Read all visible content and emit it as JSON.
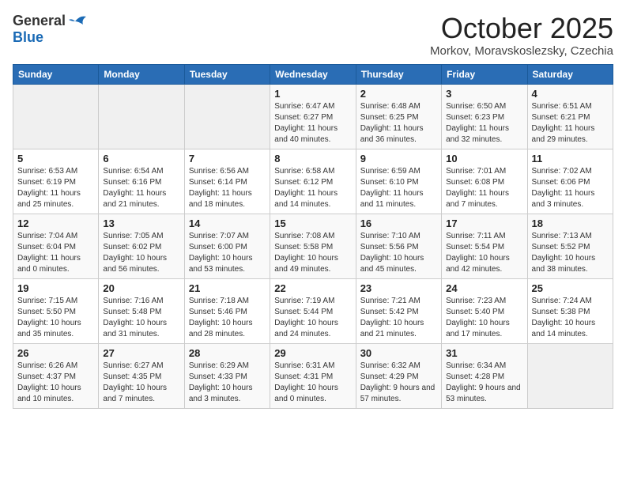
{
  "logo": {
    "general": "General",
    "blue": "Blue"
  },
  "title": "October 2025",
  "subtitle": "Morkov, Moravskoslezsky, Czechia",
  "headers": [
    "Sunday",
    "Monday",
    "Tuesday",
    "Wednesday",
    "Thursday",
    "Friday",
    "Saturday"
  ],
  "weeks": [
    [
      {
        "day": "",
        "info": ""
      },
      {
        "day": "",
        "info": ""
      },
      {
        "day": "",
        "info": ""
      },
      {
        "day": "1",
        "info": "Sunrise: 6:47 AM\nSunset: 6:27 PM\nDaylight: 11 hours and 40 minutes."
      },
      {
        "day": "2",
        "info": "Sunrise: 6:48 AM\nSunset: 6:25 PM\nDaylight: 11 hours and 36 minutes."
      },
      {
        "day": "3",
        "info": "Sunrise: 6:50 AM\nSunset: 6:23 PM\nDaylight: 11 hours and 32 minutes."
      },
      {
        "day": "4",
        "info": "Sunrise: 6:51 AM\nSunset: 6:21 PM\nDaylight: 11 hours and 29 minutes."
      }
    ],
    [
      {
        "day": "5",
        "info": "Sunrise: 6:53 AM\nSunset: 6:19 PM\nDaylight: 11 hours and 25 minutes."
      },
      {
        "day": "6",
        "info": "Sunrise: 6:54 AM\nSunset: 6:16 PM\nDaylight: 11 hours and 21 minutes."
      },
      {
        "day": "7",
        "info": "Sunrise: 6:56 AM\nSunset: 6:14 PM\nDaylight: 11 hours and 18 minutes."
      },
      {
        "day": "8",
        "info": "Sunrise: 6:58 AM\nSunset: 6:12 PM\nDaylight: 11 hours and 14 minutes."
      },
      {
        "day": "9",
        "info": "Sunrise: 6:59 AM\nSunset: 6:10 PM\nDaylight: 11 hours and 11 minutes."
      },
      {
        "day": "10",
        "info": "Sunrise: 7:01 AM\nSunset: 6:08 PM\nDaylight: 11 hours and 7 minutes."
      },
      {
        "day": "11",
        "info": "Sunrise: 7:02 AM\nSunset: 6:06 PM\nDaylight: 11 hours and 3 minutes."
      }
    ],
    [
      {
        "day": "12",
        "info": "Sunrise: 7:04 AM\nSunset: 6:04 PM\nDaylight: 11 hours and 0 minutes."
      },
      {
        "day": "13",
        "info": "Sunrise: 7:05 AM\nSunset: 6:02 PM\nDaylight: 10 hours and 56 minutes."
      },
      {
        "day": "14",
        "info": "Sunrise: 7:07 AM\nSunset: 6:00 PM\nDaylight: 10 hours and 53 minutes."
      },
      {
        "day": "15",
        "info": "Sunrise: 7:08 AM\nSunset: 5:58 PM\nDaylight: 10 hours and 49 minutes."
      },
      {
        "day": "16",
        "info": "Sunrise: 7:10 AM\nSunset: 5:56 PM\nDaylight: 10 hours and 45 minutes."
      },
      {
        "day": "17",
        "info": "Sunrise: 7:11 AM\nSunset: 5:54 PM\nDaylight: 10 hours and 42 minutes."
      },
      {
        "day": "18",
        "info": "Sunrise: 7:13 AM\nSunset: 5:52 PM\nDaylight: 10 hours and 38 minutes."
      }
    ],
    [
      {
        "day": "19",
        "info": "Sunrise: 7:15 AM\nSunset: 5:50 PM\nDaylight: 10 hours and 35 minutes."
      },
      {
        "day": "20",
        "info": "Sunrise: 7:16 AM\nSunset: 5:48 PM\nDaylight: 10 hours and 31 minutes."
      },
      {
        "day": "21",
        "info": "Sunrise: 7:18 AM\nSunset: 5:46 PM\nDaylight: 10 hours and 28 minutes."
      },
      {
        "day": "22",
        "info": "Sunrise: 7:19 AM\nSunset: 5:44 PM\nDaylight: 10 hours and 24 minutes."
      },
      {
        "day": "23",
        "info": "Sunrise: 7:21 AM\nSunset: 5:42 PM\nDaylight: 10 hours and 21 minutes."
      },
      {
        "day": "24",
        "info": "Sunrise: 7:23 AM\nSunset: 5:40 PM\nDaylight: 10 hours and 17 minutes."
      },
      {
        "day": "25",
        "info": "Sunrise: 7:24 AM\nSunset: 5:38 PM\nDaylight: 10 hours and 14 minutes."
      }
    ],
    [
      {
        "day": "26",
        "info": "Sunrise: 6:26 AM\nSunset: 4:37 PM\nDaylight: 10 hours and 10 minutes."
      },
      {
        "day": "27",
        "info": "Sunrise: 6:27 AM\nSunset: 4:35 PM\nDaylight: 10 hours and 7 minutes."
      },
      {
        "day": "28",
        "info": "Sunrise: 6:29 AM\nSunset: 4:33 PM\nDaylight: 10 hours and 3 minutes."
      },
      {
        "day": "29",
        "info": "Sunrise: 6:31 AM\nSunset: 4:31 PM\nDaylight: 10 hours and 0 minutes."
      },
      {
        "day": "30",
        "info": "Sunrise: 6:32 AM\nSunset: 4:29 PM\nDaylight: 9 hours and 57 minutes."
      },
      {
        "day": "31",
        "info": "Sunrise: 6:34 AM\nSunset: 4:28 PM\nDaylight: 9 hours and 53 minutes."
      },
      {
        "day": "",
        "info": ""
      }
    ]
  ]
}
